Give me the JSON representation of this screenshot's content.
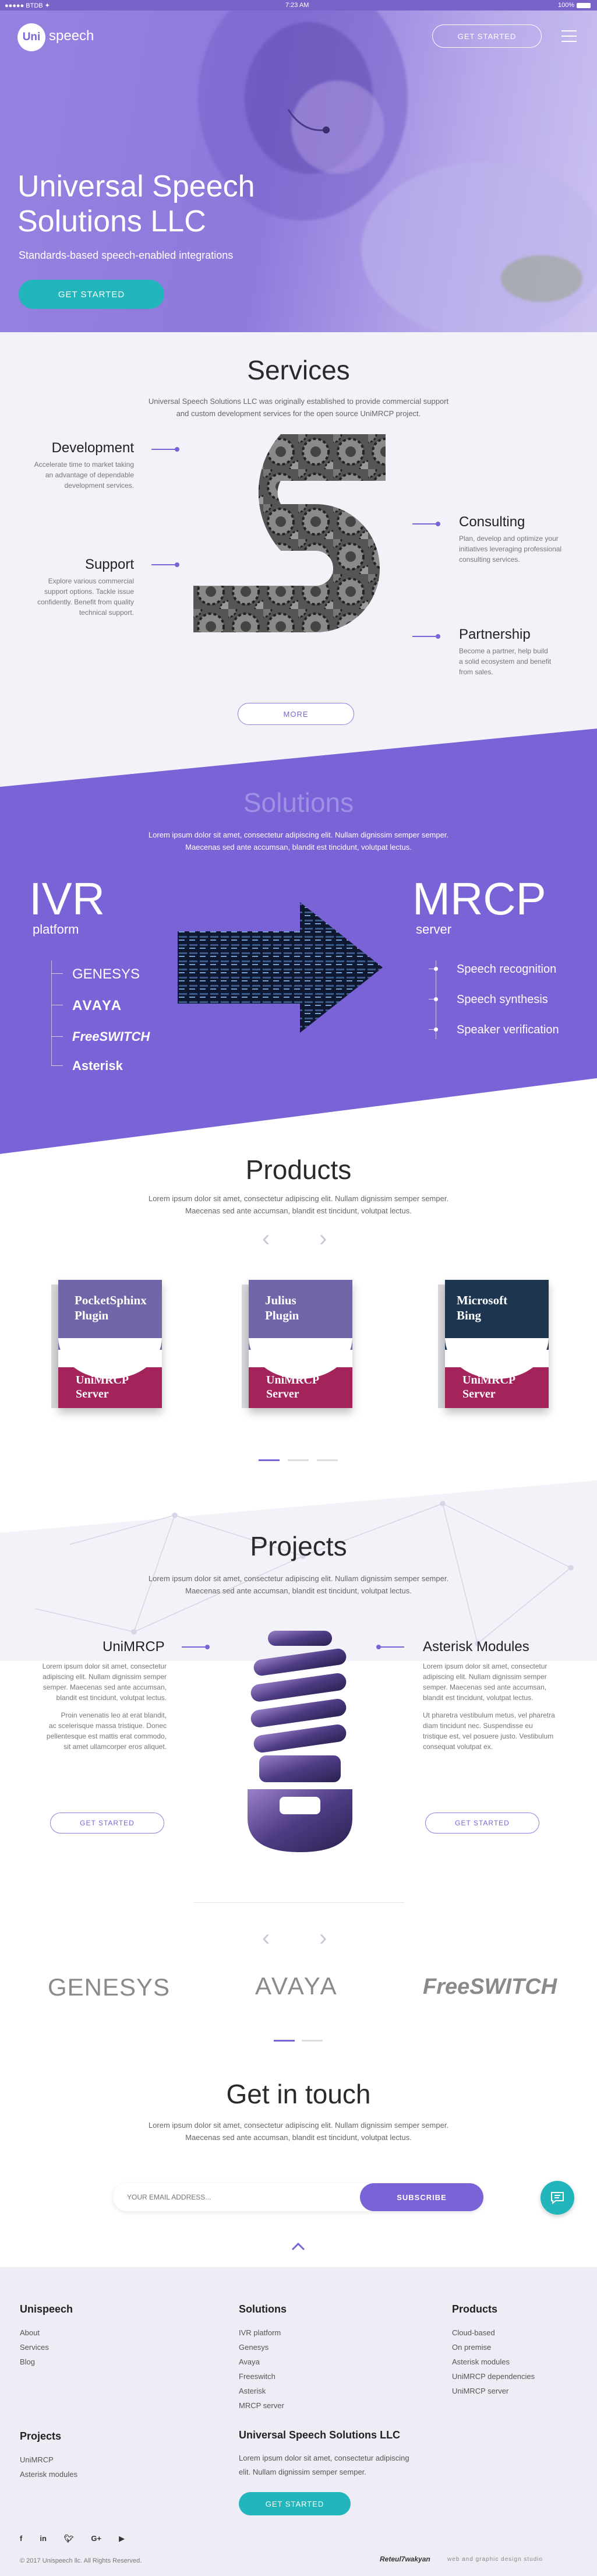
{
  "status": {
    "carrier": "●●●●● BTDB ✦",
    "time": "7:23 AM",
    "battery": "100%"
  },
  "header": {
    "logo_prefix": "Uni",
    "logo_suffix": "speech",
    "cta": "GET STARTED"
  },
  "hero": {
    "title_line1": "Universal Speech",
    "title_line2": "Solutions LLC",
    "subtitle": "Standards-based speech-enabled integrations",
    "cta": "GET STARTED"
  },
  "services": {
    "title": "Services",
    "intro_line1": "Universal Speech Solutions LLC was originally established to provide commercial support",
    "intro_line2": "and custom development services for the open source UniMRCP project.",
    "items": [
      {
        "title": "Development",
        "lines": [
          "Accelerate time to market taking",
          "an advantage of dependable",
          "development services."
        ]
      },
      {
        "title": "Support",
        "lines": [
          "Explore various commercial",
          "support options. Tackle issue",
          "confidently. Benefit from quality",
          "technical support."
        ]
      },
      {
        "title": "Consulting",
        "lines": [
          "Plan, develop and optimize your",
          "initiatives leveraging professional",
          "consulting services."
        ]
      },
      {
        "title": "Partnership",
        "lines": [
          "Become a partner, help build",
          "a solid ecosystem and benefit",
          "from sales."
        ]
      }
    ],
    "more": "MORE"
  },
  "solutions": {
    "title": "Solutions",
    "intro_line1": "Lorem ipsum dolor sit amet, consectetur adipiscing elit. Nullam dignissim semper semper.",
    "intro_line2": "Maecenas sed ante accumsan, blandit est tincidunt, volutpat lectus.",
    "left_title": "IVR",
    "left_sub": "platform",
    "left_items": [
      "GENESYS",
      "AVAYA",
      "FreeSWITCH",
      "Asterisk"
    ],
    "right_title": "MRCP",
    "right_sub": "server",
    "right_items": [
      "Speech recognition",
      "Speech synthesis",
      "Speaker verification"
    ]
  },
  "products": {
    "title": "Products",
    "intro_line1": "Lorem ipsum dolor sit amet, consectetur adipiscing elit. Nullam dignissim semper semper.",
    "intro_line2": "Maecenas sed ante accumsan, blandit est tincidunt, volutpat lectus.",
    "prev": "‹",
    "next": "›",
    "boxes": [
      {
        "title_line1": "PocketSphinx",
        "title_line2": "Plugin",
        "server_line1": "UniMRCP",
        "server_line2": "Server",
        "band": "#6f66a8"
      },
      {
        "title_line1": "Julius",
        "title_line2": "Plugin",
        "server_line1": "UniMRCP",
        "server_line2": "Server",
        "band": "#6f66a8"
      },
      {
        "title_line1": "Microsoft",
        "title_line2": "Bing",
        "server_line1": "UniMRCP",
        "server_line2": "Server",
        "band": "#1e3550"
      }
    ]
  },
  "projects": {
    "title": "Projects",
    "intro_line1": "Lorem ipsum dolor sit amet, consectetur adipiscing elit. Nullam dignissim semper semper.",
    "intro_line2": "Maecenas sed ante accumsan, blandit est tincidunt, volutpat lectus.",
    "left": {
      "title": "UniMRCP",
      "p1": [
        "Lorem ipsum dolor sit amet, consectetur",
        "adipiscing elit. Nullam dignissim semper",
        "semper. Maecenas sed ante accumsan,",
        "blandit est tincidunt, volutpat lectus."
      ],
      "p2": [
        "Proin venenatis leo at erat blandit,",
        "ac scelerisque massa tristique. Donec",
        "pellentesque est mattis erat commodo,",
        "sit amet ullamcorper eros aliquet."
      ],
      "cta": "GET STARTED"
    },
    "right": {
      "title": "Asterisk Modules",
      "p1": [
        "Lorem ipsum dolor sit amet, consectetur",
        "adipiscing elit. Nullam dignissim semper",
        "semper. Maecenas sed ante accumsan,",
        "blandit est tincidunt, volutpat lectus."
      ],
      "p2": [
        "Ut pharetra vestibulum metus, vel pharetra",
        "diam tincidunt nec. Suspendisse eu",
        "tristique est, vel posuere justo. Vestibulum",
        "consequat volutpat ex."
      ],
      "cta": "GET STARTED"
    }
  },
  "partners": {
    "prev": "‹",
    "next": "›",
    "logos": [
      "GENESYS",
      "AVAYA",
      "FreeSWITCH"
    ]
  },
  "contact": {
    "title": "Get in touch",
    "intro_line1": "Lorem ipsum dolor sit amet, consectetur adipiscing elit. Nullam dignissim semper semper.",
    "intro_line2": "Maecenas sed ante accumsan, blandit est tincidunt, volutpat lectus.",
    "email_placeholder": "YOUR EMAIL ADDRESS...",
    "subscribe": "SUBSCRIBE"
  },
  "footer": {
    "col1": {
      "title": "Unispeech",
      "links": [
        "About",
        "Services",
        "Blog"
      ]
    },
    "col2": {
      "title": "Solutions",
      "links": [
        "IVR platform",
        "Genesys",
        "Avaya",
        "Freeswitch",
        "Asterisk",
        "MRCP server"
      ]
    },
    "col3": {
      "title": "Products",
      "links": [
        "Cloud-based",
        "On premise",
        "Asterisk modules",
        "UniMRCP dependencies",
        "UniMRCP server"
      ]
    },
    "col4": {
      "title": "Projects",
      "links": [
        "UniMRCP",
        "Asterisk modules"
      ]
    },
    "company": {
      "title": "Universal Speech Solutions LLC",
      "line1": "Lorem ipsum dolor sit amet, consectetur adipiscing",
      "line2": "elit. Nullam dignissim semper semper.",
      "cta": "GET STARTED"
    },
    "copyright": "© 2017 Unispeech llc. All Rights Reserved.",
    "credit_brand": "Reteul7wakyan",
    "credit_rest": "web and graphic design studio"
  },
  "colors": {
    "accent": "#7a63d6",
    "teal": "#22b6bc",
    "magenta": "#a4235a"
  }
}
